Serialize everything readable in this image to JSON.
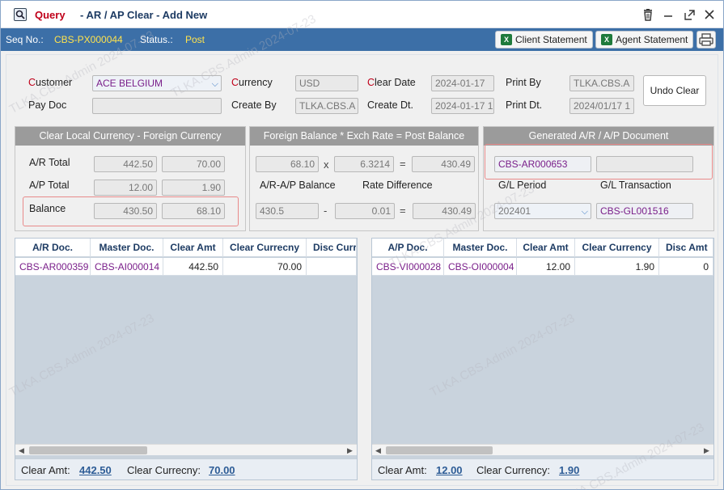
{
  "title": {
    "mode": "Query",
    "text": "- AR / AP Clear - Add New"
  },
  "titlebar_icons": [
    "search-icon",
    "trash-icon",
    "minimize-icon",
    "maximize-icon",
    "close-icon"
  ],
  "infobar": {
    "seq_label": "Seq No.:",
    "seq_value": "CBS-PX000044",
    "status_label": "Status.:",
    "status_value": "Post",
    "client_statement": "Client Statement",
    "agent_statement": "Agent Statement"
  },
  "header": {
    "customer_label_first": "C",
    "customer_label_rest": "ustomer",
    "customer_value": "ACE BELGIUM",
    "currency_label_first": "C",
    "currency_label_rest": "urrency",
    "currency_value": "USD",
    "clear_date_label_first": "C",
    "clear_date_label_rest": "lear Date",
    "clear_date_value": "2024-01-17",
    "print_by_label": "Print By",
    "print_by_value": "TLKA.CBS.A",
    "pay_doc_label": "Pay Doc",
    "pay_doc_value": "",
    "create_by_label": "Create By",
    "create_by_value": "TLKA.CBS.A",
    "create_dt_label": "Create Dt.",
    "create_dt_value": "2024-01-17 1",
    "print_dt_label": "Print Dt.",
    "print_dt_value": "2024/01/17 1",
    "undo_clear": "Undo Clear"
  },
  "panel_local": {
    "title": "Clear Local Currency - Foreign Currency",
    "ar_total_label": "A/R Total",
    "ar_total_local": "442.50",
    "ar_total_foreign": "70.00",
    "ap_total_label": "A/P Total",
    "ap_total_local": "12.00",
    "ap_total_foreign": "1.90",
    "balance_label": "Balance",
    "balance_local": "430.50",
    "balance_foreign": "68.10"
  },
  "panel_foreign": {
    "title": "Foreign Balance * Exch Rate = Post Balance",
    "foreign_balance": "68.10",
    "times": "x",
    "exch_rate": "6.3214",
    "equals": "=",
    "post_balance": "430.49",
    "ar_ap_balance_label": "A/R-A/P Balance",
    "rate_difference_label": "Rate Difference",
    "ar_ap_balance": "430.5",
    "minus": "-",
    "rate_difference": "0.01",
    "equals2": "=",
    "result": "430.49"
  },
  "panel_generated": {
    "title": "Generated A/R / A/P Document",
    "document_no": "CBS-AR000653",
    "document_extra": "",
    "gl_period_label": "G/L Period",
    "gl_transaction_label": "G/L Transaction",
    "gl_period": "202401",
    "gl_transaction": "CBS-GL001516"
  },
  "ar_grid": {
    "columns": [
      "A/R Doc.",
      "Master Doc.",
      "Clear Amt",
      "Clear Currecny",
      "Disc Curr"
    ],
    "rows": [
      {
        "doc": "CBS-AR000359",
        "master": "CBS-AI000014",
        "clear_amt": "442.50",
        "clear_curr": "70.00"
      }
    ],
    "footer_amt_label": "Clear Amt:",
    "footer_amt": "442.50",
    "footer_curr_label": "Clear Currecny:",
    "footer_curr": "70.00"
  },
  "ap_grid": {
    "columns": [
      "A/P Doc.",
      "Master Doc.",
      "Clear Amt",
      "Clear Currency",
      "Disc Amt"
    ],
    "rows": [
      {
        "doc": "CBS-VI000028",
        "master": "CBS-OI000004",
        "clear_amt": "12.00",
        "clear_curr": "1.90",
        "disc_amt": "0"
      }
    ],
    "footer_amt_label": "Clear Amt:",
    "footer_amt": "12.00",
    "footer_curr_label": "Clear Currency:",
    "footer_curr": "1.90"
  },
  "watermark": "TLKA.CBS.Admin 2024-07-23"
}
